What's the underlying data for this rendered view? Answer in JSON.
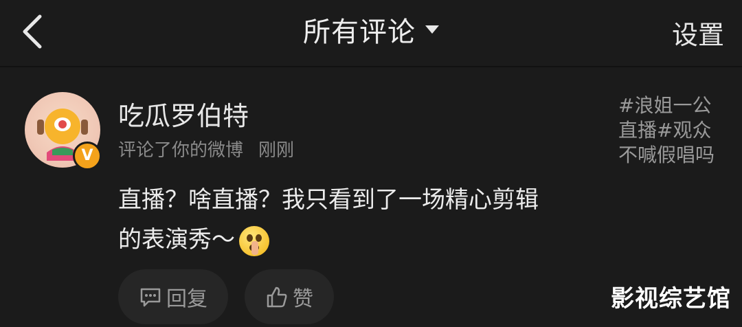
{
  "header": {
    "title": "所有评论",
    "settings_label": "设置"
  },
  "comment": {
    "username": "吃瓜罗伯特",
    "action": "评论了你的微博",
    "time": "刚刚",
    "text_line1": "直播？啥直播？我只看到了一场精心剪辑",
    "text_line2": "的表演秀～",
    "emoji": "shushing-face-icon",
    "badge": "V"
  },
  "post_preview": {
    "lines": [
      "#浪姐一公",
      "直播#观众",
      "不喊假唱吗"
    ]
  },
  "actions": {
    "reply_label": "回复",
    "like_label": "赞"
  },
  "watermark": "影视综艺馆",
  "colors": {
    "background": "#1b1b1b",
    "badge": "#f4a21b"
  }
}
